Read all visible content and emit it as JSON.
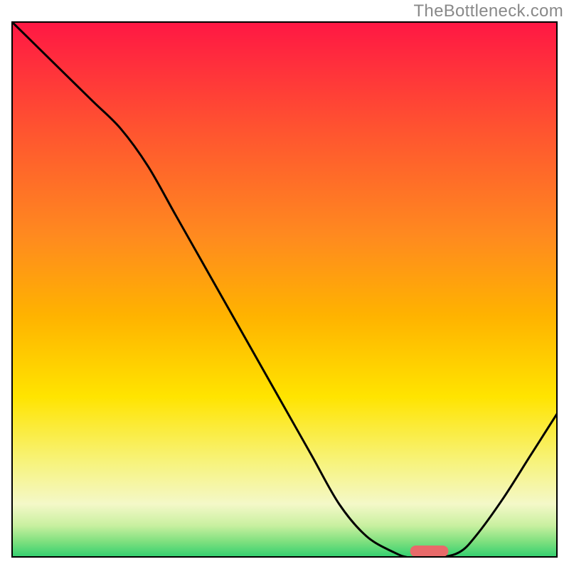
{
  "watermark": "TheBottleneck.com",
  "chart_data": {
    "type": "line",
    "x": [
      0.0,
      0.05,
      0.1,
      0.15,
      0.2,
      0.25,
      0.3,
      0.35,
      0.4,
      0.45,
      0.5,
      0.55,
      0.6,
      0.65,
      0.7,
      0.73,
      0.78,
      0.82,
      0.85,
      0.9,
      0.95,
      1.0
    ],
    "values": [
      1.0,
      0.95,
      0.9,
      0.85,
      0.8,
      0.73,
      0.64,
      0.55,
      0.46,
      0.37,
      0.28,
      0.19,
      0.1,
      0.04,
      0.01,
      0.0,
      0.0,
      0.01,
      0.04,
      0.11,
      0.19,
      0.27
    ],
    "title": "",
    "xlabel": "",
    "ylabel": "",
    "xlim": [
      0,
      1
    ],
    "ylim": [
      0,
      1
    ],
    "marker_pill": {
      "x_start": 0.73,
      "x_end": 0.8,
      "y": 0.012
    },
    "background_gradient": {
      "type": "vertical",
      "stops": [
        {
          "offset": 0.0,
          "color": "#ff1744"
        },
        {
          "offset": 0.2,
          "color": "#ff5330"
        },
        {
          "offset": 0.4,
          "color": "#ff8a1f"
        },
        {
          "offset": 0.55,
          "color": "#ffb300"
        },
        {
          "offset": 0.7,
          "color": "#ffe400"
        },
        {
          "offset": 0.82,
          "color": "#f7f37a"
        },
        {
          "offset": 0.9,
          "color": "#f4f8c8"
        },
        {
          "offset": 0.94,
          "color": "#c9f0a0"
        },
        {
          "offset": 0.97,
          "color": "#7fe07f"
        },
        {
          "offset": 1.0,
          "color": "#2fcf6f"
        }
      ]
    },
    "marker_color": "#e86a6a",
    "curve_color": "#000000"
  }
}
